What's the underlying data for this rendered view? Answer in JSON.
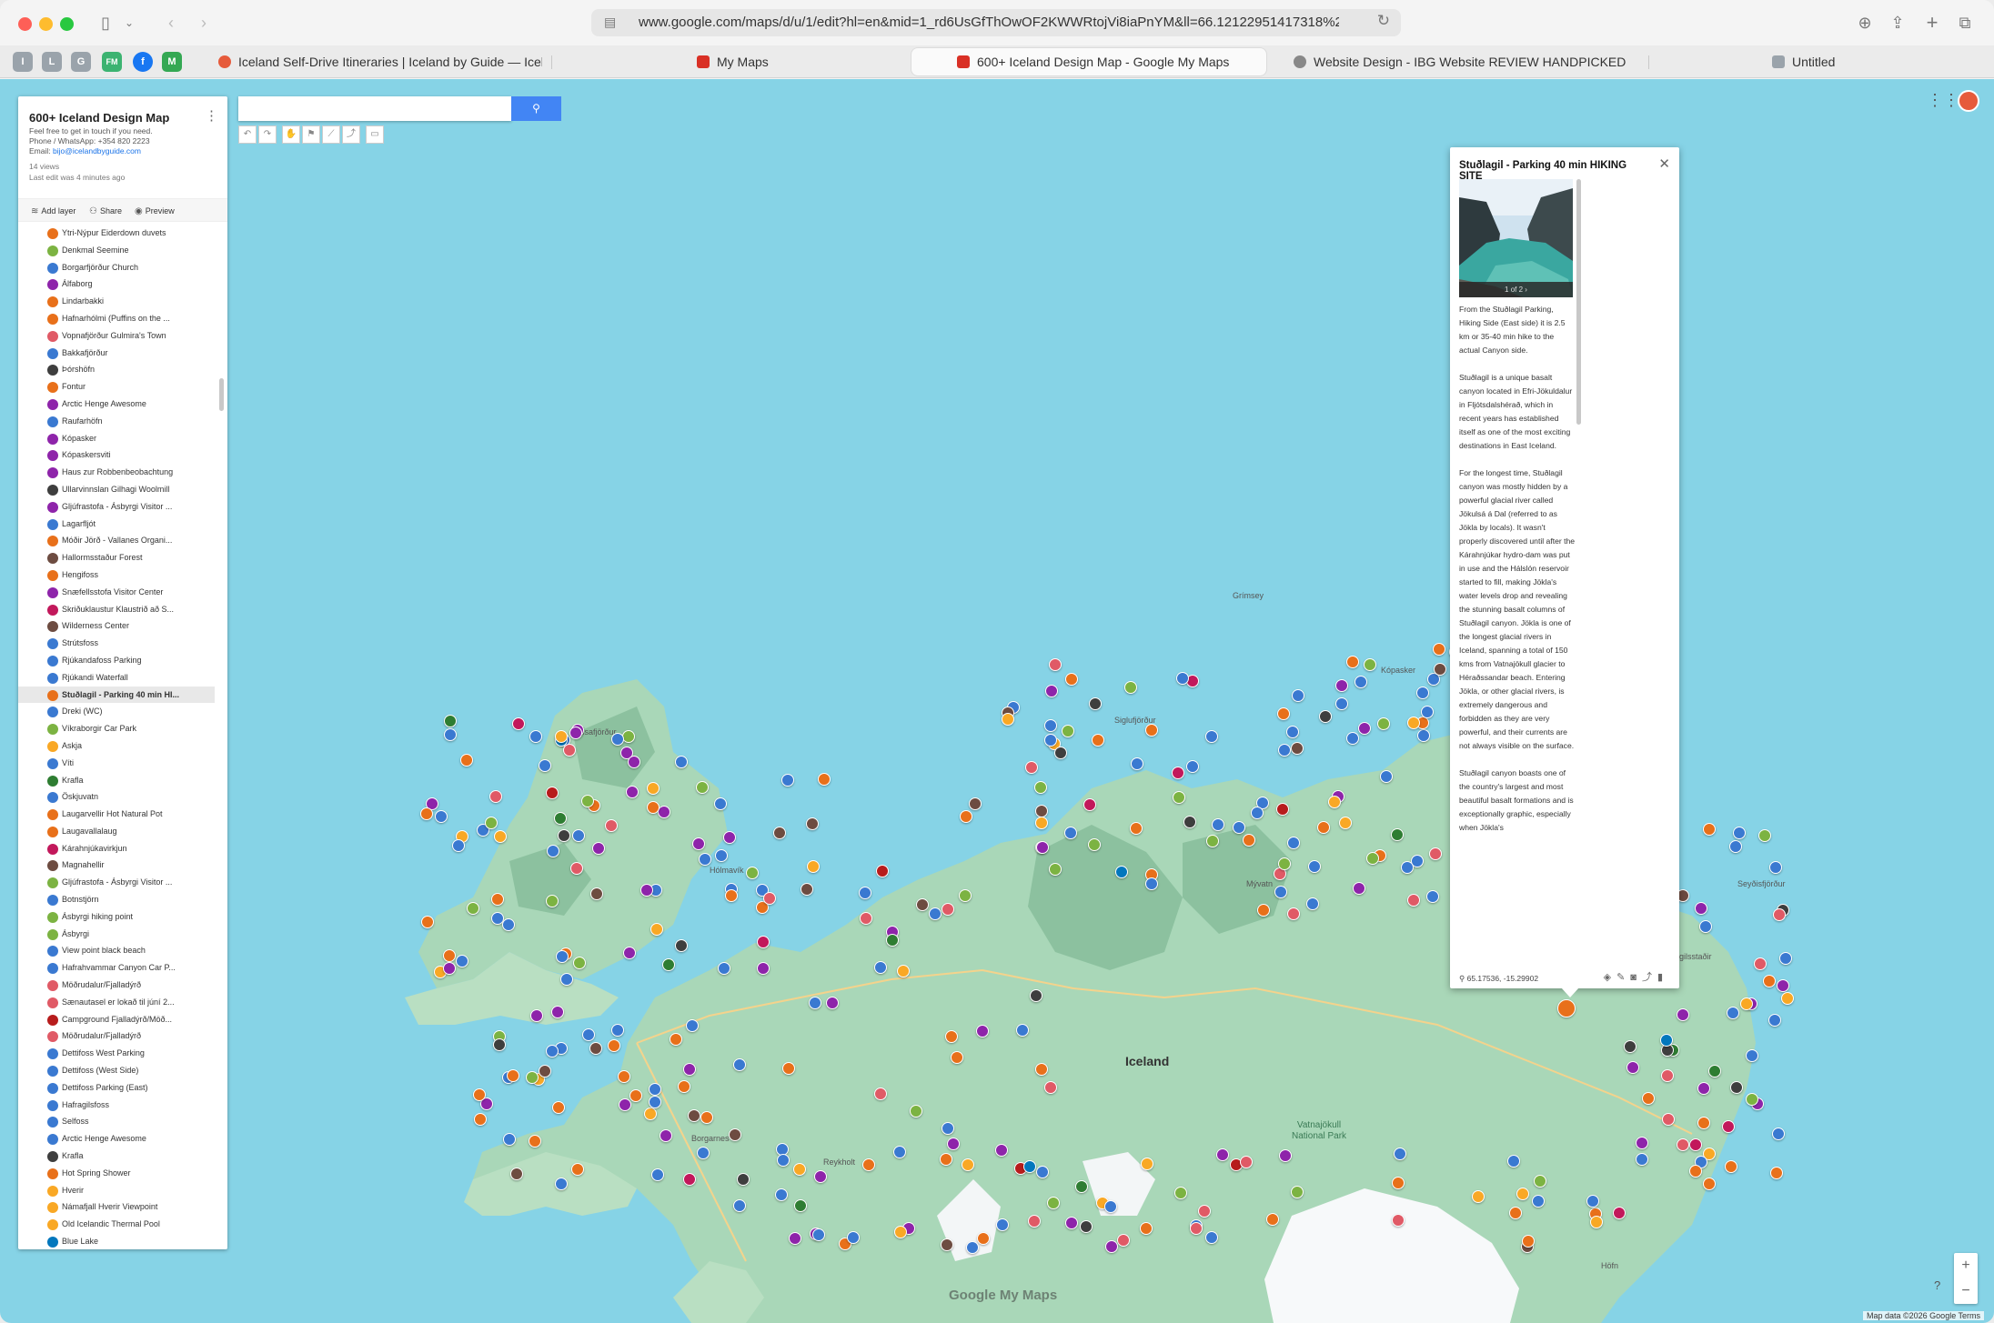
{
  "browser": {
    "url": "www.google.com/maps/d/u/1/edit?hl=en&mid=1_rd6UsGfThOwOF2KWWRtojVi8iaPnYM&ll=66.12122951417318%2C-19.8415647607",
    "tabs": [
      {
        "label": "Iceland Self-Drive Itineraries | Iceland by Guide — Icel..."
      },
      {
        "label": "My Maps"
      },
      {
        "label": "600+ Iceland Design Map - Google My Maps"
      },
      {
        "label": "Website Design - IBG Website REVIEW HANDPICKED"
      },
      {
        "label": "Untitled"
      }
    ],
    "pinned": [
      "I",
      "L",
      "G",
      "FM",
      "f",
      "M"
    ],
    "colors": {
      "close": "#fe5f57",
      "minimize": "#febc2e",
      "zoom": "#28c840"
    }
  },
  "panel": {
    "title": "600+ Iceland Design Map",
    "desc_line1": "Feel free to get in touch if you need.",
    "desc_line2": "Phone / WhatsApp: +354 820 2223",
    "email_label": "Email:",
    "email": "bijo@icelandbyguide.com",
    "views": "14 views",
    "last_edit": "Last edit was 4 minutes ago",
    "add_layer": "Add layer",
    "share": "Share",
    "preview": "Preview",
    "places": [
      {
        "name": "Ytri-Nýpur Eiderdown duvets",
        "color": "#e8701a"
      },
      {
        "name": "Denkmal Seemine",
        "color": "#7cb342"
      },
      {
        "name": "Borgarfjörður Church",
        "color": "#3a79d1"
      },
      {
        "name": "Álfaborg",
        "color": "#8e24aa"
      },
      {
        "name": "Lindarbakki",
        "color": "#e8701a"
      },
      {
        "name": "Hafnarhólmi (Puffins on the ...",
        "color": "#e8701a"
      },
      {
        "name": "Vopnafjörður Gulmira's Town",
        "color": "#e05a66"
      },
      {
        "name": "Bakkafjörður",
        "color": "#3a79d1"
      },
      {
        "name": "Þórshöfn",
        "color": "#3e3e3e"
      },
      {
        "name": "Fontur",
        "color": "#e8701a"
      },
      {
        "name": "Arctic Henge Awesome",
        "color": "#8e24aa"
      },
      {
        "name": "Raufarhöfn",
        "color": "#3a79d1"
      },
      {
        "name": "Kópasker",
        "color": "#8e24aa"
      },
      {
        "name": "Kópaskersviti",
        "color": "#8e24aa"
      },
      {
        "name": "Haus zur Robbenbeobachtung",
        "color": "#8e24aa"
      },
      {
        "name": "Ullarvinnslan Gilhagi Woolmill",
        "color": "#3e3e3e"
      },
      {
        "name": "Gljúfrastofa - Ásbyrgi Visitor ...",
        "color": "#8e24aa"
      },
      {
        "name": "Lagarfljót",
        "color": "#3a79d1"
      },
      {
        "name": "Móðir Jörð - Vallanes Organi...",
        "color": "#e8701a"
      },
      {
        "name": "Hallormsstaður Forest",
        "color": "#6d4c41"
      },
      {
        "name": "Hengifoss",
        "color": "#e8701a"
      },
      {
        "name": "Snæfellsstofa Visitor Center",
        "color": "#8e24aa"
      },
      {
        "name": "Skriðuklaustur Klaustrið að S...",
        "color": "#c2185b"
      },
      {
        "name": "Wilderness Center",
        "color": "#6d4c41"
      },
      {
        "name": "Strútsfoss",
        "color": "#3a79d1"
      },
      {
        "name": "Rjúkandafoss Parking",
        "color": "#3a79d1"
      },
      {
        "name": "Rjúkandi Waterfall",
        "color": "#3a79d1"
      },
      {
        "name": "Stuðlagil - Parking 40 min HI...",
        "color": "#e8701a",
        "selected": true
      },
      {
        "name": "Dreki (WC)",
        "color": "#3a79d1"
      },
      {
        "name": "Víkraborgir Car Park",
        "color": "#7cb342"
      },
      {
        "name": "Askja",
        "color": "#f9a825"
      },
      {
        "name": "Víti",
        "color": "#3a79d1"
      },
      {
        "name": "Krafla",
        "color": "#2e7d32"
      },
      {
        "name": "Öskjuvatn",
        "color": "#3a79d1"
      },
      {
        "name": "Laugarvellir Hot Natural Pot",
        "color": "#e8701a"
      },
      {
        "name": "Laugavallalaug",
        "color": "#e8701a"
      },
      {
        "name": "Kárahnjúkavirkjun",
        "color": "#c2185b"
      },
      {
        "name": "Magnahellir",
        "color": "#6d4c41"
      },
      {
        "name": "Gljúfrastofa - Ásbyrgi Visitor ...",
        "color": "#7cb342"
      },
      {
        "name": "Botnstjörn",
        "color": "#3a79d1"
      },
      {
        "name": "Ásbyrgi hiking point",
        "color": "#7cb342"
      },
      {
        "name": "Ásbyrgi",
        "color": "#7cb342"
      },
      {
        "name": "View point black beach",
        "color": "#3a79d1"
      },
      {
        "name": "Hafrahvammar Canyon Car P...",
        "color": "#3a79d1"
      },
      {
        "name": "Möðrudalur/Fjalladýrð",
        "color": "#e05a66"
      },
      {
        "name": "Sænautasel er lokað til júní 2...",
        "color": "#e05a66"
      },
      {
        "name": "Campground Fjalladýrð/Möð...",
        "color": "#b71c1c"
      },
      {
        "name": "Möðrudalur/Fjalladýrð",
        "color": "#e05a66"
      },
      {
        "name": "Dettifoss West Parking",
        "color": "#3a79d1"
      },
      {
        "name": "Dettifoss (West Side)",
        "color": "#3a79d1"
      },
      {
        "name": "Dettifoss Parking (East)",
        "color": "#3a79d1"
      },
      {
        "name": "Hafragilsfoss",
        "color": "#3a79d1"
      },
      {
        "name": "Selfoss",
        "color": "#3a79d1"
      },
      {
        "name": "Arctic Henge Awesome",
        "color": "#3a79d1"
      },
      {
        "name": "Krafla",
        "color": "#3e3e3e"
      },
      {
        "name": "Hot Spring Shower",
        "color": "#e8701a"
      },
      {
        "name": "Hverir",
        "color": "#f9a825"
      },
      {
        "name": "Námafjall Hverir Viewpoint",
        "color": "#f9a825"
      },
      {
        "name": "Old Icelandic Thermal Pool",
        "color": "#f9a825"
      },
      {
        "name": "Blue Lake",
        "color": "#0277bd"
      }
    ]
  },
  "popup": {
    "title": "Stuðlagil - Parking 40 min HIKING SITE",
    "photo_caption": "1 of 2",
    "paragraphs": [
      "From the Stuðlagil Parking, Hiking Side (East side) it is 2.5 km or 35-40 min hike to the actual Canyon side.",
      "Stuðlagil is a unique basalt canyon located in Efri-Jökuldalur in Fljótsdalshérað, which in recent years has established itself as one of the most exciting destinations in East Iceland.",
      "For the longest time, Stuðlagil canyon was mostly hidden by a powerful glacial river called Jökulsá á Dal (referred to as Jökla by locals). It wasn't properly discovered until after the Kárahnjúkar hydro-dam was put in use and the Hálslón reservoir started to fill, making Jökla's water levels drop and revealing the stunning basalt columns of Stuðlagil canyon. Jökla is one of the longest glacial rivers in Iceland, spanning a total of 150 kms from Vatnajökull glacier to Héraðssandar beach. Entering Jökla, or other glacial rivers, is extremely dangerous and forbidden as they are very powerful, and their currents are not always visible on the surface.",
      "Stuðlagil canyon boasts one of the country's largest and most beautiful basalt formations and is exceptionally graphic, especially when Jökla's"
    ],
    "coords": "65.17536, -15.29902"
  },
  "map": {
    "country_label": "Iceland",
    "park_label_1": "Vatnajökull",
    "park_label_2": "National Park",
    "watermark": "Google My Maps",
    "attribution": "Map data ©2026 Google  Terms",
    "labels": [
      {
        "text": "Grímsey"
      },
      {
        "text": "Kópasker"
      },
      {
        "text": "Ísafjörður"
      },
      {
        "text": "Siglufjörður"
      },
      {
        "text": "Mývatn"
      },
      {
        "text": "Seyðisfjörður"
      },
      {
        "text": "Egilsstaðir"
      },
      {
        "text": "Hólmavík"
      },
      {
        "text": "Reykholt"
      },
      {
        "text": "Borgarnes"
      },
      {
        "text": "Höfn"
      }
    ]
  }
}
